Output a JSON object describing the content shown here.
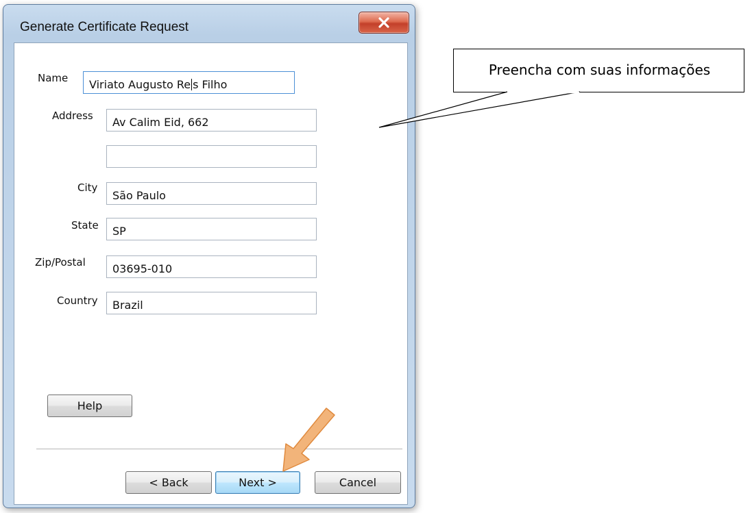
{
  "window": {
    "title": "Generate Certificate Request"
  },
  "form": {
    "name_label": "Name",
    "name_value_before_caret": "Viriato Augusto Re",
    "name_value_after_caret": "s Filho",
    "address_label": "Address",
    "address_line1": "Av Calim Eid, 662",
    "address_line2": "",
    "city_label": "City",
    "city_value": "São Paulo",
    "state_label": "State",
    "state_value": "SP",
    "zip_label": "Zip/Postal",
    "zip_value": "03695-010",
    "country_label": "Country",
    "country_value": "Brazil"
  },
  "buttons": {
    "help": "Help",
    "back": "< Back",
    "next": "Next >",
    "cancel": "Cancel"
  },
  "annotation": {
    "callout_text": "Preencha com suas informações",
    "arrow_color": "#f2b47a",
    "arrow_stroke": "#e08a3e"
  },
  "colors": {
    "window_frame": "#c8dbee",
    "close_button": "#c3402a",
    "default_button_border": "#3c7fb1"
  }
}
